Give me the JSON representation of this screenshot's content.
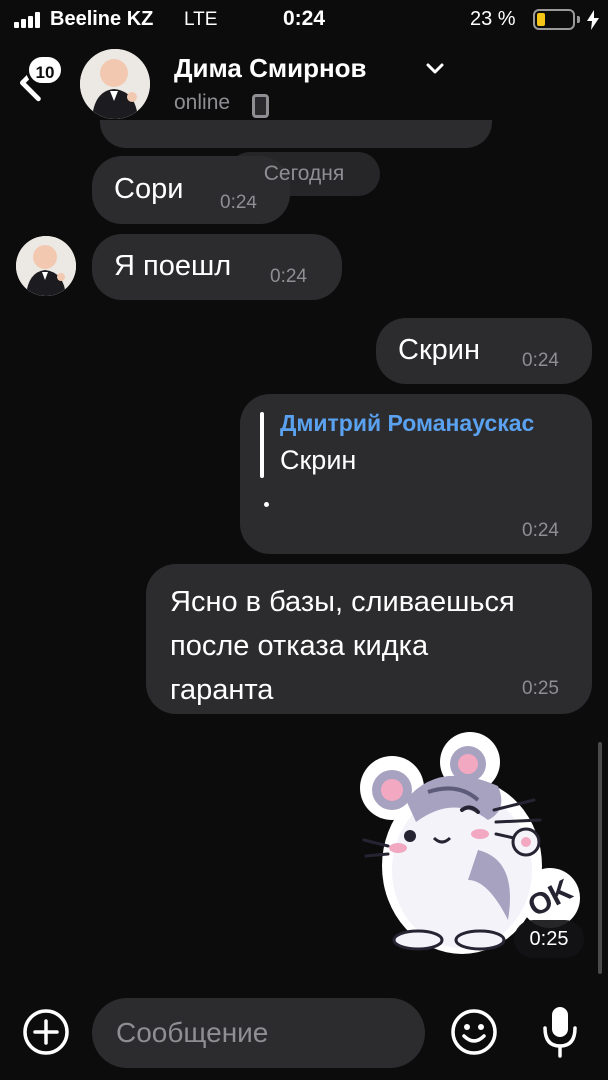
{
  "status_bar": {
    "carrier": "Beeline KZ",
    "network": "LTE",
    "time": "0:24",
    "battery_percent": "23 %",
    "battery_level": 0.23,
    "battery_color": "#f5c518"
  },
  "header": {
    "back_badge": "10",
    "contact_name": "Дима Смирнов",
    "contact_status": "online"
  },
  "chat": {
    "date_separator": "Сегодня",
    "messages": [
      {
        "text": "Сори",
        "time": "0:24"
      },
      {
        "text": "Я поешл",
        "time": "0:24"
      },
      {
        "text": "Скрин",
        "time": "0:24"
      },
      {
        "reply_author": "Дмитрий Романаускас",
        "reply_text": "Скрин",
        "text": "",
        "time": "0:24"
      },
      {
        "lines": [
          "Ясно в базы, сливаешься",
          "после отказа кидка",
          "гаранта"
        ],
        "time": "0:25"
      },
      {
        "sticker_text": "OK",
        "time": "0:25"
      }
    ]
  },
  "input": {
    "placeholder": "Сообщение"
  },
  "colors": {
    "background": "#0c0c0d",
    "bubble": "#2c2c2e",
    "secondary_text": "#8e8e93",
    "reply_name": "#5aa2ef"
  }
}
